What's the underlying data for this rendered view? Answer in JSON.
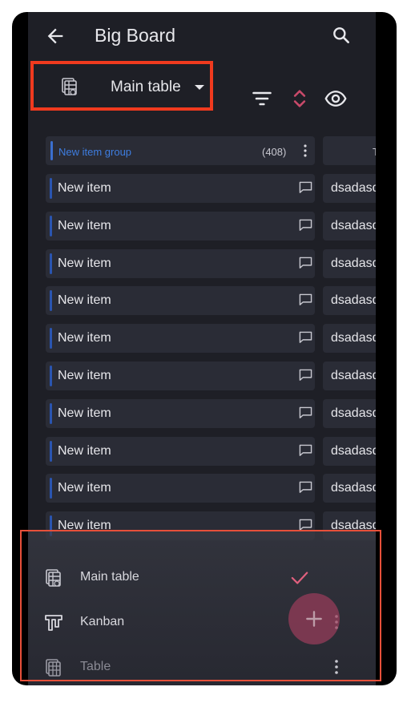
{
  "app": {
    "title": "Big Board"
  },
  "view_selector": {
    "label": "Main table"
  },
  "group": {
    "name": "New item group",
    "count": "(408)"
  },
  "side_header_text": "T",
  "rows": [
    {
      "name": "New item",
      "cell": "dsadasd"
    },
    {
      "name": "New item",
      "cell": "dsadasd"
    },
    {
      "name": "New item",
      "cell": "dsadasd"
    },
    {
      "name": "New item",
      "cell": "dsadasd"
    },
    {
      "name": "New item",
      "cell": "dsadasd"
    },
    {
      "name": "New item",
      "cell": "dsadasd"
    },
    {
      "name": "New item",
      "cell": "dsadasd"
    },
    {
      "name": "New item",
      "cell": "dsadasd"
    },
    {
      "name": "New item",
      "cell": "dsadasd"
    },
    {
      "name": "New item",
      "cell": "dsadasd"
    }
  ],
  "sheet": {
    "items": [
      {
        "label": "Main table",
        "icon": "board-table-icon",
        "selected": true
      },
      {
        "label": "Kanban",
        "icon": "kanban-icon",
        "selected": false
      },
      {
        "label": "Table",
        "icon": "table-icon",
        "selected": false
      }
    ]
  },
  "colors": {
    "background": "#1e1f26",
    "row": "#2a2c36",
    "accent_blue": "#3e7de0",
    "highlight_red": "#f03a1e",
    "sort_icon": "#c94a6a",
    "check": "#e0607e"
  }
}
